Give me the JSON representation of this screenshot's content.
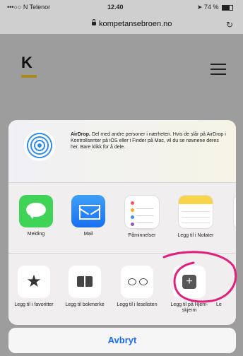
{
  "status_bar": {
    "carrier": "•••○○ N Telenor",
    "time": "12.40",
    "battery": "74 %",
    "battery_level": 0.74
  },
  "browser": {
    "url": "kompetansebroen.no"
  },
  "site": {
    "logo": "K"
  },
  "share_sheet": {
    "airdrop": {
      "title": "AirDrop.",
      "text": "Del med andre personer i nærheten. Hvis de slår på AirDrop i Kontrollsenter på iOS eller i Finder på Mac, vil du se navnene deres her. Bare klikk for å dele."
    },
    "apps": [
      {
        "label": "Melding",
        "icon": "messages-icon"
      },
      {
        "label": "Mail",
        "icon": "mail-icon"
      },
      {
        "label": "Påminnelser",
        "icon": "reminders-icon"
      },
      {
        "label": "Legg til i Notater",
        "icon": "notes-icon"
      }
    ],
    "actions": [
      {
        "label": "Legg til i favoritter",
        "icon": "star-icon"
      },
      {
        "label": "Legg til bokmerke",
        "icon": "book-icon"
      },
      {
        "label": "Legg til i leselisten",
        "icon": "glasses-icon"
      },
      {
        "label": "Legg til på Hjem-skjerm",
        "icon": "plus-square-icon"
      },
      {
        "label": "Le",
        "icon": "partial-icon"
      }
    ],
    "cancel_label": "Avbryt"
  },
  "colors": {
    "accent": "#1a6ff1",
    "annotation": "#e0207a",
    "logo_bar": "#a88a20"
  }
}
